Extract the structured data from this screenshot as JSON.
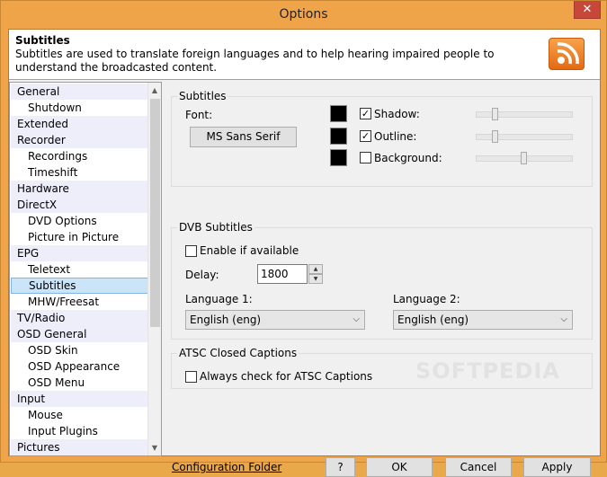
{
  "window": {
    "title": "Options",
    "close_glyph": "✕"
  },
  "header": {
    "title": "Subtitles",
    "description": "Subtitles are used to translate foreign languages and to help hearing impaired people to understand the broadcasted content.",
    "icon": "rss-icon",
    "icon_colors": {
      "top": "#f7a24a",
      "bottom": "#e46a12"
    }
  },
  "nav": {
    "items": [
      {
        "label": "General",
        "level": 0
      },
      {
        "label": "Shutdown",
        "level": 1
      },
      {
        "label": "Extended",
        "level": 0
      },
      {
        "label": "Recorder",
        "level": 0
      },
      {
        "label": "Recordings",
        "level": 1
      },
      {
        "label": "Timeshift",
        "level": 1
      },
      {
        "label": "Hardware",
        "level": 0
      },
      {
        "label": "DirectX",
        "level": 0
      },
      {
        "label": "DVD Options",
        "level": 1
      },
      {
        "label": "Picture in Picture",
        "level": 1
      },
      {
        "label": "EPG",
        "level": 0
      },
      {
        "label": "Teletext",
        "level": 1
      },
      {
        "label": "Subtitles",
        "level": 1,
        "selected": true
      },
      {
        "label": "MHW/Freesat",
        "level": 1
      },
      {
        "label": "TV/Radio",
        "level": 0
      },
      {
        "label": "OSD General",
        "level": 0
      },
      {
        "label": "OSD Skin",
        "level": 1
      },
      {
        "label": "OSD Appearance",
        "level": 1
      },
      {
        "label": "OSD Menu",
        "level": 1
      },
      {
        "label": "Input",
        "level": 0
      },
      {
        "label": "Mouse",
        "level": 1
      },
      {
        "label": "Input Plugins",
        "level": 1
      },
      {
        "label": "Pictures",
        "level": 0
      }
    ]
  },
  "subtitles_group": {
    "title": "Subtitles",
    "font_label": "Font:",
    "font_button": "MS Sans Serif",
    "shadow": {
      "label": "Shadow:",
      "checked": true,
      "color": "#000000",
      "level": 0.2
    },
    "outline": {
      "label": "Outline:",
      "checked": true,
      "color": "#000000",
      "level": 0.2
    },
    "background": {
      "label": "Background:",
      "checked": false,
      "color": "#000000",
      "level": 0.5
    }
  },
  "dvb_group": {
    "title": "DVB Subtitles",
    "enable_label": "Enable if available",
    "enable_checked": false,
    "delay_label": "Delay:",
    "delay_value": "1800",
    "language1_label": "Language 1:",
    "language1_value": "English (eng)",
    "language2_label": "Language 2:",
    "language2_value": "English (eng)"
  },
  "atsc_group": {
    "title": "ATSC Closed Captions",
    "always_label": "Always check for ATSC Captions",
    "always_checked": false
  },
  "footer": {
    "config_link": "Configuration Folder",
    "help": "?",
    "ok": "OK",
    "cancel": "Cancel",
    "apply": "Apply"
  },
  "watermark": "SOFTPEDIA"
}
